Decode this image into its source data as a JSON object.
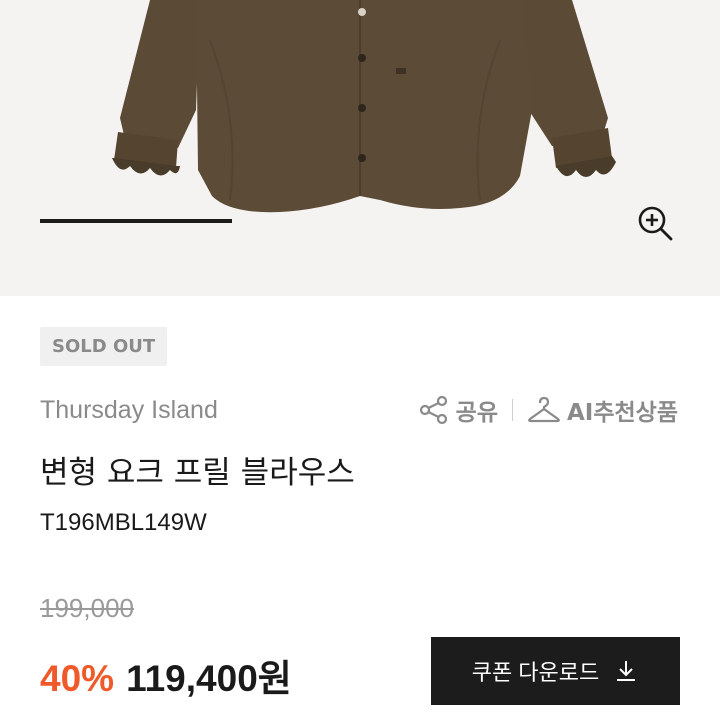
{
  "gallery": {
    "image_alt": "brown button-front blouse with frilled lace cuffs",
    "slide_progress": 0.3,
    "zoom_icon": "zoom-in-icon"
  },
  "product": {
    "status_badge": "SOLD OUT",
    "brand": "Thursday Island",
    "name": "변형 요크 프릴 블라우스",
    "code": "T196MBL149W"
  },
  "actions": {
    "share_label": "공유",
    "share_icon": "share-icon",
    "ai_label": "AI추천상품",
    "ai_icon": "hanger-icon"
  },
  "pricing": {
    "original_price": "199,000",
    "discount": "40%",
    "sale_price": "119,400원",
    "accent_color": "#f05a28"
  },
  "coupon": {
    "label": "쿠폰 다운로드",
    "icon": "download-icon"
  }
}
